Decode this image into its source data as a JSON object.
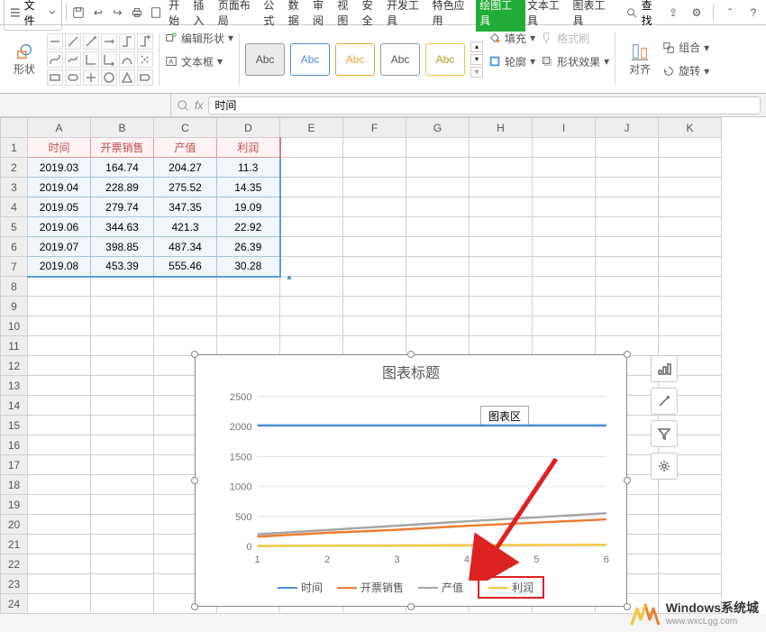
{
  "menubar": {
    "file": "文件",
    "tabs": [
      "开始",
      "插入",
      "页面布局",
      "公式",
      "数据",
      "审阅",
      "视图",
      "安全",
      "开发工具",
      "特色应用",
      "绘图工具",
      "文本工具",
      "图表工具"
    ],
    "active_tab_index": 10,
    "search": "查找"
  },
  "ribbon": {
    "shape_btn": "形状",
    "edit_shape": "编辑形状",
    "text_box": "文本框",
    "gallery_label": "Abc",
    "fill": "填充",
    "outline": "轮廓",
    "format_painter": "格式刷",
    "shape_effects": "形状效果",
    "align": "对齐",
    "group": "组合",
    "rotate": "旋转"
  },
  "formula": {
    "fx_value": "时间"
  },
  "sheet": {
    "columns": [
      "A",
      "B",
      "C",
      "D",
      "E",
      "F",
      "G",
      "H",
      "I",
      "J",
      "K"
    ],
    "rows": [
      1,
      2,
      3,
      4,
      5,
      6,
      7,
      8,
      9,
      10,
      11,
      12,
      13,
      14,
      15,
      16,
      17,
      18,
      19,
      20,
      21,
      22,
      23,
      24
    ],
    "headers": [
      "时间",
      "开票销售",
      "产值",
      "利润"
    ],
    "data": [
      [
        "2019.03",
        "164.74",
        "204.27",
        "11.3"
      ],
      [
        "2019.04",
        "228.89",
        "275.52",
        "14.35"
      ],
      [
        "2019.05",
        "279.74",
        "347.35",
        "19.09"
      ],
      [
        "2019.06",
        "344.63",
        "421.3",
        "22.92"
      ],
      [
        "2019.07",
        "398.85",
        "487.34",
        "26.39"
      ],
      [
        "2019.08",
        "453.39",
        "555.46",
        "30.28"
      ]
    ]
  },
  "chart_data": {
    "type": "line",
    "title": "图表标题",
    "badge": "图表区",
    "x": [
      1,
      2,
      3,
      4,
      5,
      6
    ],
    "ylim": [
      0,
      2500
    ],
    "yticks": [
      0,
      500,
      1000,
      1500,
      2000,
      2500
    ],
    "series": [
      {
        "name": "时间",
        "color": "#4a90d9",
        "values": [
          2019.03,
          2019.04,
          2019.05,
          2019.06,
          2019.07,
          2019.08
        ]
      },
      {
        "name": "开票销售",
        "color": "#ed7d31",
        "values": [
          164.74,
          228.89,
          279.74,
          344.63,
          398.85,
          453.39
        ]
      },
      {
        "name": "产值",
        "color": "#a5a5a5",
        "values": [
          204.27,
          275.52,
          347.35,
          421.3,
          487.34,
          555.46
        ]
      },
      {
        "name": "利润",
        "color": "#f3c843",
        "values": [
          11.3,
          14.35,
          19.09,
          22.92,
          26.39,
          30.28
        ]
      }
    ]
  },
  "watermark": {
    "title": "Windows系统城",
    "sub": "www.wxcLgg.com"
  }
}
